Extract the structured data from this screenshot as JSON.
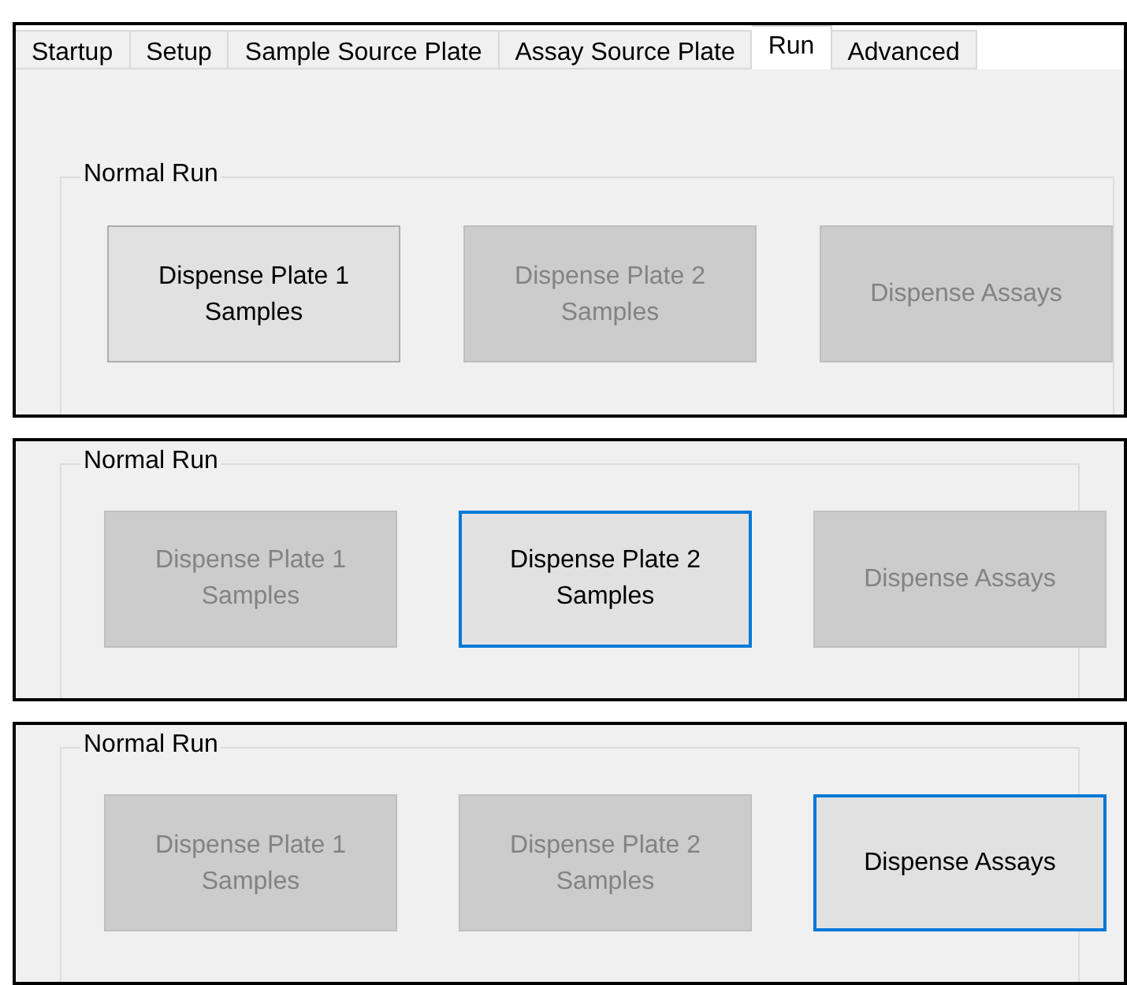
{
  "panels": [
    {
      "tabs": [
        {
          "label": "Startup",
          "selected": false
        },
        {
          "label": "Setup",
          "selected": false
        },
        {
          "label": "Sample Source Plate",
          "selected": false
        },
        {
          "label": "Assay Source Plate",
          "selected": false
        },
        {
          "label": "Run",
          "selected": true
        },
        {
          "label": "Advanced",
          "selected": false
        }
      ],
      "group": {
        "title": "Normal Run",
        "buttons": [
          {
            "label": "Dispense Plate 1\nSamples",
            "disabled": false,
            "focused": false
          },
          {
            "label": "Dispense Plate 2\nSamples",
            "disabled": true,
            "focused": false
          },
          {
            "label": "Dispense Assays",
            "disabled": true,
            "focused": false
          }
        ]
      }
    },
    {
      "group": {
        "title": "Normal Run",
        "buttons": [
          {
            "label": "Dispense Plate 1\nSamples",
            "disabled": true,
            "focused": false
          },
          {
            "label": "Dispense Plate 2\nSamples",
            "disabled": false,
            "focused": true
          },
          {
            "label": "Dispense Assays",
            "disabled": true,
            "focused": false
          }
        ]
      }
    },
    {
      "group": {
        "title": "Normal Run",
        "buttons": [
          {
            "label": "Dispense Plate 1\nSamples",
            "disabled": true,
            "focused": false
          },
          {
            "label": "Dispense Plate 2\nSamples",
            "disabled": true,
            "focused": false
          },
          {
            "label": "Dispense Assays",
            "disabled": false,
            "focused": true
          }
        ]
      }
    }
  ]
}
